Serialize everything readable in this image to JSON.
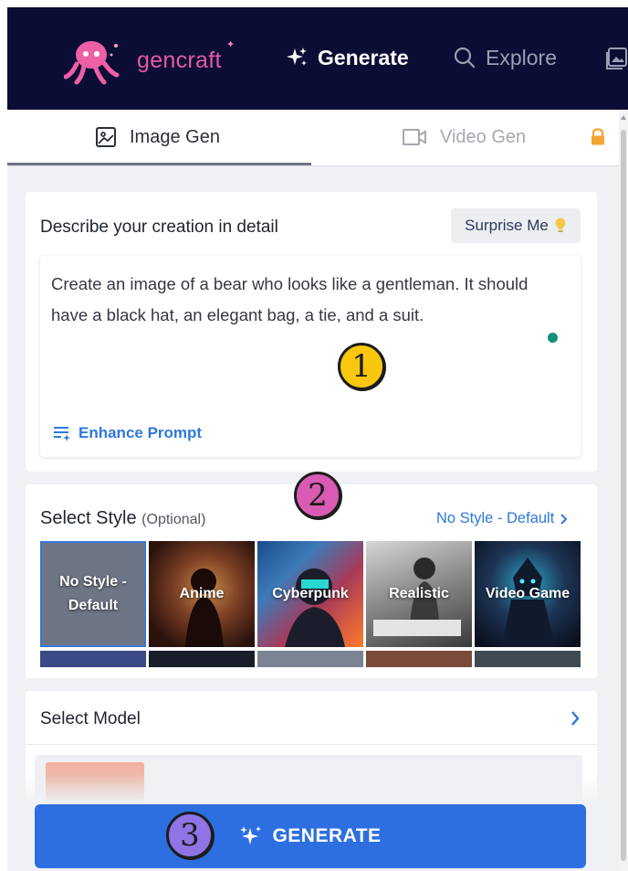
{
  "app": {
    "logo_text": "gencraft",
    "nav": {
      "generate": "Generate",
      "explore": "Explore"
    }
  },
  "tabs": {
    "image": "Image Gen",
    "video": "Video Gen"
  },
  "prompt": {
    "label": "Describe your creation in detail",
    "surprise_label": "Surprise Me",
    "value": "Create an image of a bear who looks like a gentleman. It should have a black hat, an elegant bag, a tie, and a suit.",
    "enhance_label": "Enhance Prompt"
  },
  "style": {
    "label": "Select Style",
    "optional": "(Optional)",
    "selected_link": "No Style - Default",
    "options": [
      {
        "label": "No Style - Default",
        "selected": true
      },
      {
        "label": "Anime",
        "selected": false
      },
      {
        "label": "Cyberpunk",
        "selected": false
      },
      {
        "label": "Realistic",
        "selected": false
      },
      {
        "label": "Video Game",
        "selected": false
      }
    ]
  },
  "model": {
    "label": "Select Model"
  },
  "generate_label": "GENERATE",
  "badges": [
    "1",
    "2",
    "3"
  ],
  "colors": {
    "nav_bg": "#0b0d34",
    "accent": "#2d6fe0",
    "link": "#2f78dc",
    "badge_1": "#f9c80e",
    "badge_2": "#d95bb3",
    "badge_3": "#8f74e6"
  }
}
